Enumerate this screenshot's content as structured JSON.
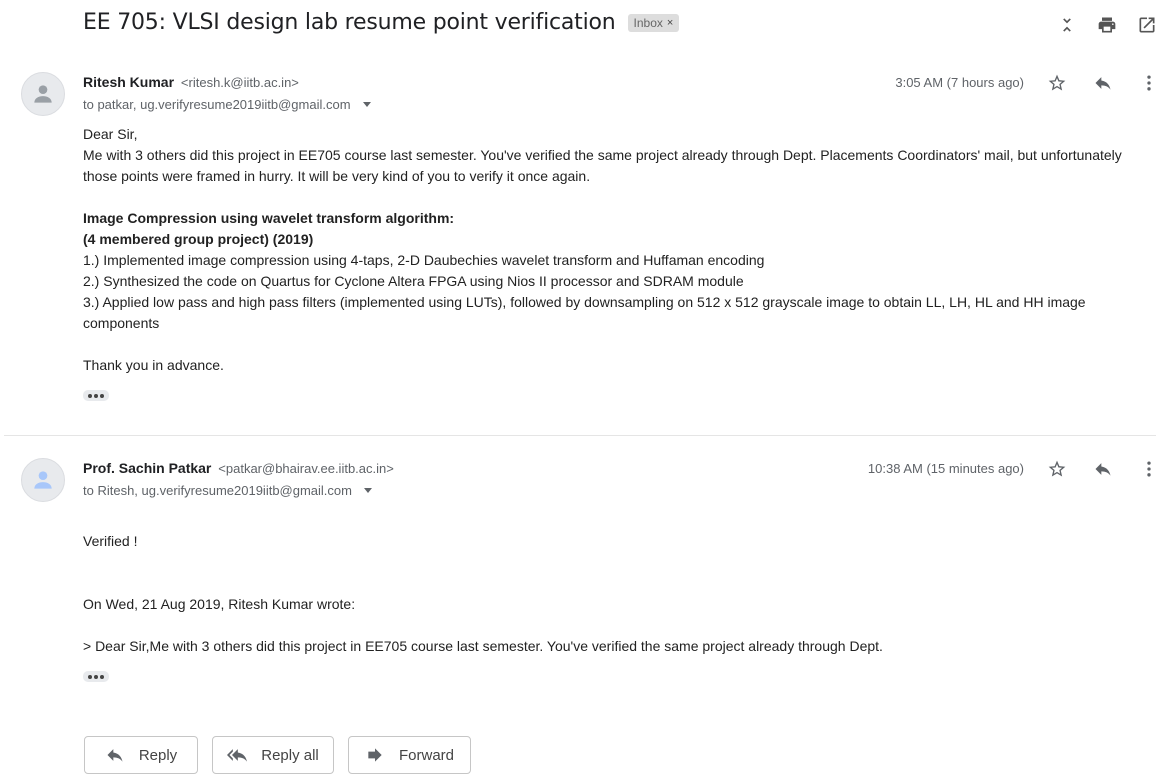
{
  "thread": {
    "subject": "EE 705: VLSI design lab resume point verification",
    "label": "Inbox",
    "label_remove": "×"
  },
  "messages": [
    {
      "sender_name": "Ritesh Kumar",
      "sender_email": "<ritesh.k@iitb.ac.in>",
      "recipients": "to patkar, ug.verifyresume2019iitb@gmail.com",
      "time": "3:05 AM (7 hours ago)",
      "lines": [
        "Dear Sir,",
        "Me with 3 others did this project in EE705 course last semester. You've verified the same project already through Dept. Placements Coordinators' mail, but unfortunately those points were framed in hurry. It will be very kind of you to verify it once again.",
        "Image Compression using wavelet transform algorithm:",
        "(4 membered group project) (2019)",
        "1.)  Implemented image compression using 4-taps, 2-D Daubechies wavelet transform and Huffaman encoding",
        "2.) Synthesized the code on Quartus for Cyclone Altera FPGA using Nios II processor and SDRAM module",
        "3.)  Applied low pass and high pass filters (implemented using LUTs), followed by downsampling on 512 x 512 grayscale image to obtain LL, LH, HL and HH image components",
        "Thank you in advance."
      ]
    },
    {
      "sender_name": "Prof. Sachin Patkar",
      "sender_email": "<patkar@bhairav.ee.iitb.ac.in>",
      "recipients": "to Ritesh, ug.verifyresume2019iitb@gmail.com",
      "time": "10:38 AM (15 minutes ago)",
      "lines": [
        "Verified !",
        "On Wed, 21 Aug 2019, Ritesh Kumar wrote:",
        "> Dear Sir,Me with 3 others did this project in EE705 course last semester. You've verified the same project already through Dept."
      ]
    }
  ],
  "actions": {
    "reply": "Reply",
    "reply_all": "Reply all",
    "forward": "Forward"
  },
  "icons": [
    "collapse-icon",
    "print-icon",
    "open-in-new-icon",
    "star-icon",
    "reply-icon",
    "more-vert-icon",
    "person-icon",
    "reply-all-icon",
    "forward-icon"
  ],
  "colors": {
    "label_bg": "#dddddd",
    "avatar_person_first": "#9aa0a6",
    "avatar_person_second": "#a8c7fa"
  }
}
